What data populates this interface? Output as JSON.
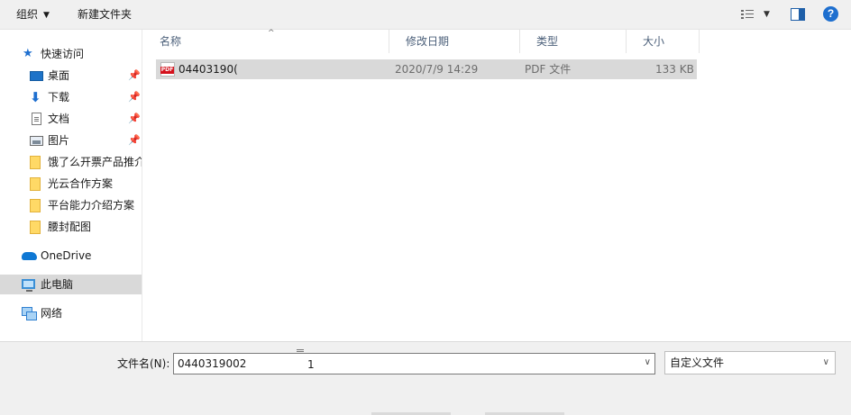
{
  "toolbar": {
    "organize_label": "组织",
    "new_folder_label": "新建文件夹"
  },
  "nav": {
    "quick_access": "快速访问",
    "items": [
      {
        "label": "桌面",
        "icon": "desktop-icon",
        "pinned": true
      },
      {
        "label": "下载",
        "icon": "download-icon",
        "pinned": true
      },
      {
        "label": "文档",
        "icon": "document-icon",
        "pinned": true
      },
      {
        "label": "图片",
        "icon": "pictures-icon",
        "pinned": true
      },
      {
        "label": "饿了么开票产品推介",
        "icon": "folder-icon",
        "pinned": false
      },
      {
        "label": "光云合作方案",
        "icon": "folder-icon",
        "pinned": false
      },
      {
        "label": "平台能力介绍方案",
        "icon": "folder-icon",
        "pinned": false
      },
      {
        "label": "腰封配图",
        "icon": "folder-icon",
        "pinned": false
      }
    ],
    "onedrive": "OneDrive",
    "this_pc": "此电脑",
    "network": "网络"
  },
  "columns": {
    "name": "名称",
    "modified": "修改日期",
    "type": "类型",
    "size": "大小"
  },
  "files": [
    {
      "name": "04403190(",
      "modified": "2020/7/9 14:29",
      "type": "PDF 文件",
      "size": "133 KB"
    }
  ],
  "bottom": {
    "filename_label": "文件名(N):",
    "filename_value": "0440319002",
    "filename_suffix": "1",
    "filetype_value": "自定义文件"
  },
  "colors": {
    "accent": "#1e6fcf",
    "selection": "#d9d9d9",
    "header_text": "#4c607a",
    "pdf_red": "#d4111c"
  }
}
